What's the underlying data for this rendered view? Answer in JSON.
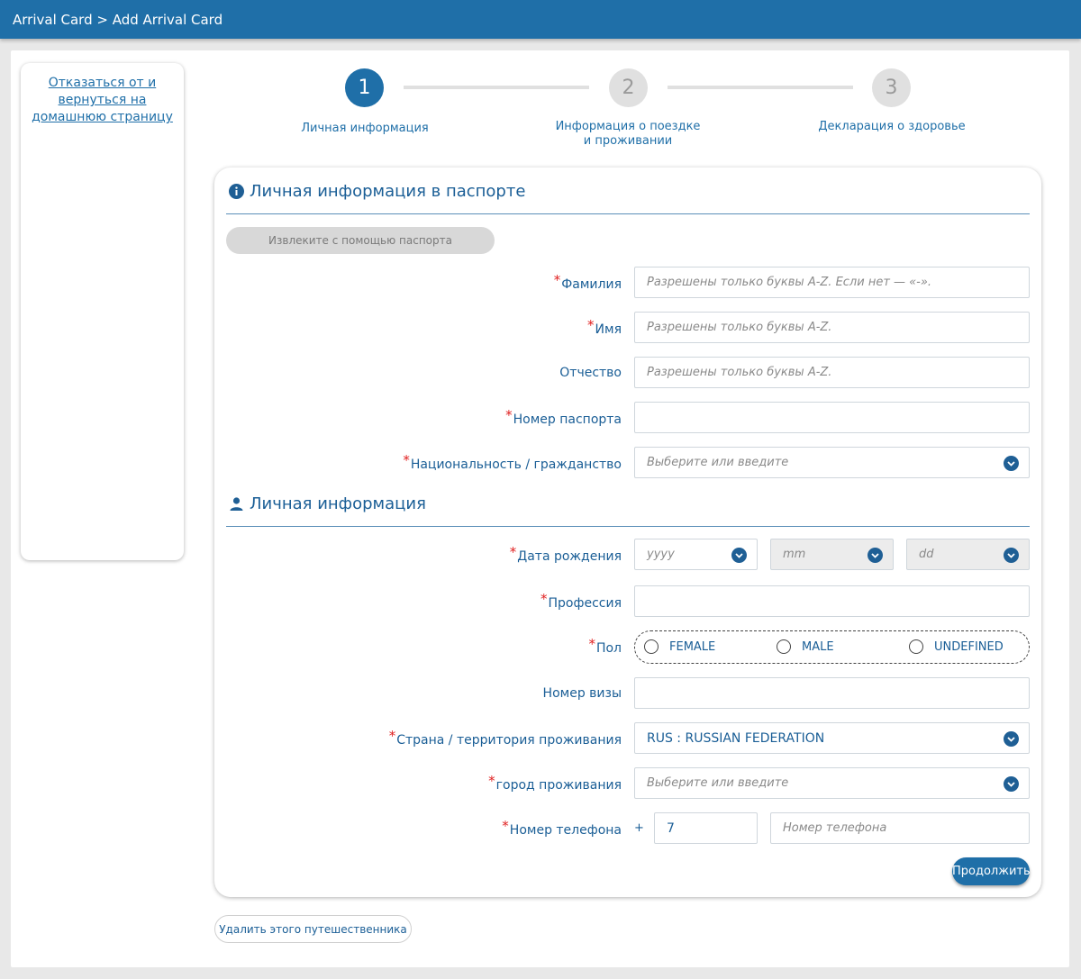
{
  "header": {
    "breadcrumb": "Arrival Card > Add Arrival Card"
  },
  "sidebar": {
    "cancel_link": "Отказаться от и вернуться на домашнюю страницу"
  },
  "stepper": {
    "steps": [
      {
        "number": "1",
        "label": "Личная информация",
        "active": true
      },
      {
        "number": "2",
        "label": "Информация о поездке и проживании",
        "active": false
      },
      {
        "number": "3",
        "label": "Декларация о здоровье",
        "active": false
      }
    ]
  },
  "passport_section": {
    "title": "Личная информация в паспорте",
    "icon": "info-icon",
    "extract_button": "Извлеките с помощью паспорта",
    "fields": {
      "surname": {
        "label": "Фамилия",
        "required": true,
        "placeholder": "Разрешены только буквы A-Z. Если нет — «-»."
      },
      "first_name": {
        "label": "Имя",
        "required": true,
        "placeholder": "Разрешены только буквы A-Z."
      },
      "patronymic": {
        "label": "Отчество",
        "required": false,
        "placeholder": "Разрешены только буквы A-Z."
      },
      "passport_number": {
        "label": "Номер паспорта",
        "required": true,
        "value": ""
      },
      "nationality": {
        "label": "Национальность / гражданство",
        "required": true,
        "placeholder": "Выберите или введите"
      }
    }
  },
  "personal_section": {
    "title": "Личная информация",
    "icon": "person-icon",
    "fields": {
      "birth_date": {
        "label": "Дата рождения",
        "required": true,
        "year_placeholder": "yyyy",
        "month_placeholder": "mm",
        "day_placeholder": "dd"
      },
      "profession": {
        "label": "Профессия",
        "required": true,
        "value": ""
      },
      "gender": {
        "label": "Пол",
        "required": true,
        "options": [
          "FEMALE",
          "MALE",
          "UNDEFINED"
        ],
        "selected": null
      },
      "visa_number": {
        "label": "Номер визы",
        "required": false,
        "value": ""
      },
      "residence_country": {
        "label": "Страна / территория проживания",
        "required": true,
        "value": "RUS : RUSSIAN FEDERATION"
      },
      "residence_city": {
        "label": "город проживания",
        "required": true,
        "placeholder": "Выберите или введите"
      },
      "phone": {
        "label": "Номер телефона",
        "required": true,
        "prefix": "+",
        "country_code": "7",
        "placeholder": "Номер телефона"
      }
    }
  },
  "buttons": {
    "continue": "Продолжить",
    "delete_traveler": "Удалить этого путешественника"
  },
  "colors": {
    "primary": "#1f6fa8",
    "required": "#e02020",
    "text": "#1a5e96"
  }
}
